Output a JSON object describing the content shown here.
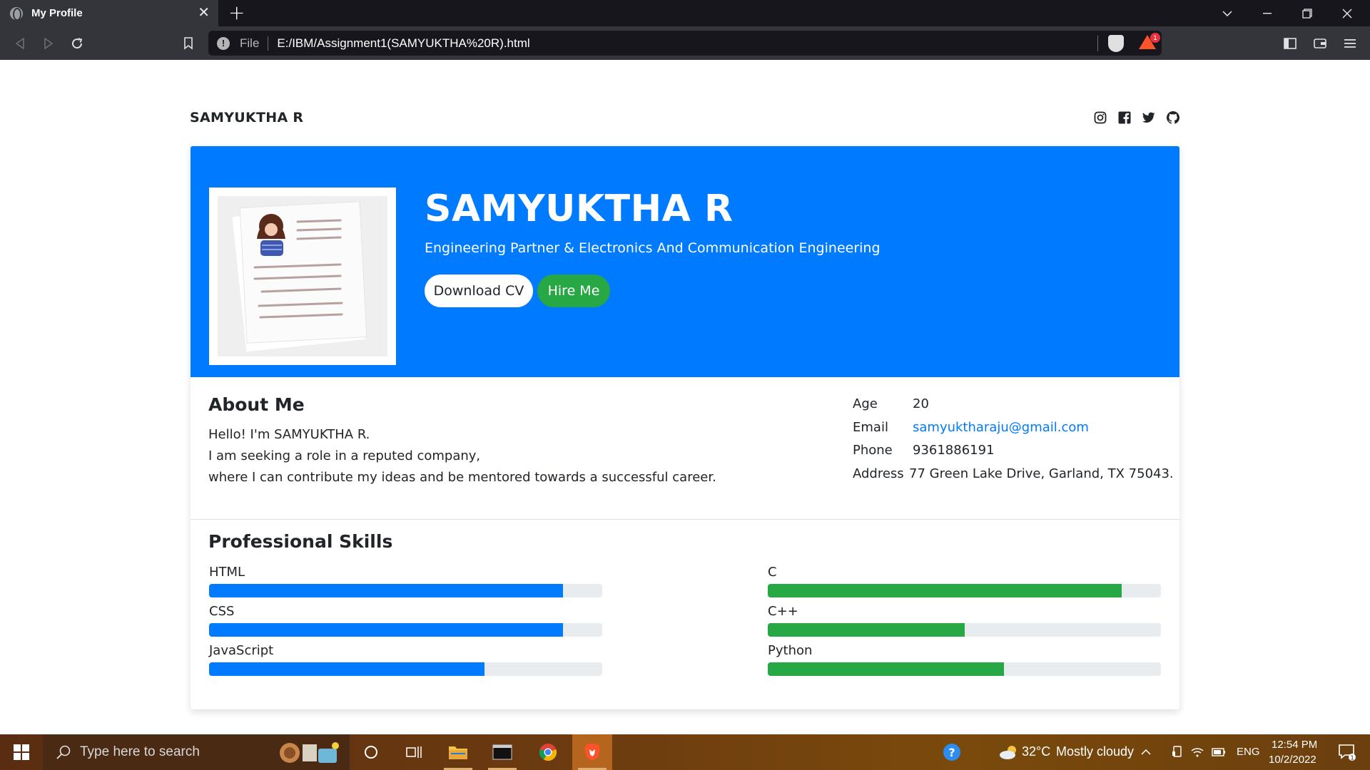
{
  "browser": {
    "tab_title": "My Profile",
    "tab_close": "✕",
    "new_tab": "+",
    "url_scheme_label": "File",
    "url": "E:/IBM/Assignment1(SAMYUKTHA%20R).html",
    "rewards_badge": "1"
  },
  "site": {
    "brand": "SAMYUKTHA R",
    "socials": [
      "instagram-icon",
      "facebook-icon",
      "twitter-icon",
      "github-icon"
    ]
  },
  "hero": {
    "name": "SAMYUKTHA R",
    "subtitle": "Engineering Partner & Electronics And Communication Engineering",
    "download_cv": "Download CV",
    "hire_me": "Hire Me",
    "hero_color": "#007bff"
  },
  "about": {
    "title": "About Me",
    "lines": [
      "Hello! I'm SAMYUKTHA R.",
      "I am seeking a role in a reputed company,",
      "where I can contribute my ideas and be mentored towards a successful career."
    ],
    "info": [
      {
        "key": "Age",
        "value": "20"
      },
      {
        "key": "Email",
        "value": "samyuktharaju@gmail.com"
      },
      {
        "key": "Phone",
        "value": "9361886191"
      },
      {
        "key": "Address",
        "value": "77 Green Lake Drive, Garland, TX 75043."
      }
    ]
  },
  "skills": {
    "title": "Professional Skills",
    "left": [
      {
        "name": "HTML",
        "percent": 90
      },
      {
        "name": "CSS",
        "percent": 90
      },
      {
        "name": "JavaScript",
        "percent": 70
      }
    ],
    "right": [
      {
        "name": "C",
        "percent": 90
      },
      {
        "name": "C++",
        "percent": 50
      },
      {
        "name": "Python",
        "percent": 60
      }
    ],
    "left_color": "#007bff",
    "right_color": "#28a745"
  },
  "taskbar": {
    "search_placeholder": "Type here to search",
    "temperature": "32°C",
    "weather": "Mostly cloudy",
    "language": "ENG",
    "time": "12:54 PM",
    "date": "10/2/2022",
    "notification_count": "1"
  }
}
